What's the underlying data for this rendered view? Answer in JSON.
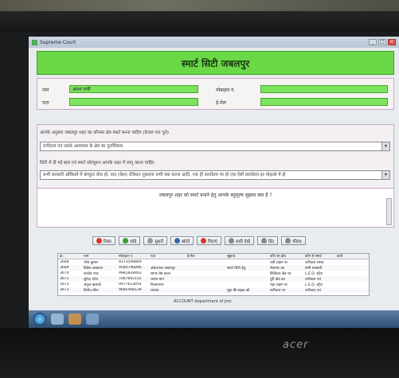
{
  "window": {
    "title": "Supreme Court"
  },
  "header": {
    "title": "स्मार्ट सिटी जबलपुर"
  },
  "form": {
    "name_label": "नाम",
    "name_value": "आशा रानी",
    "address_label": "पता",
    "mobile_label": "मोबाइल नं.",
    "email_label": "ई-मेल"
  },
  "question1": {
    "label": "आपके अनुसार जबलपुर शहर का कौनसा क्षेत्र स्मार्ट बनना चाहिए (केवल एक चुने)",
    "selected": "रानीताल एवं उसके आसपास के क्षेत्र का पुनर्विकास"
  },
  "question2": {
    "label": "सिटी में दी गई बाल एवं स्मार्ट सॉल्यूशन आपके शहर में लागू करना चाहिए",
    "selected": "सभी सरकारी ऑफ़िसों में कंप्यूटर सेवा हो, वाद (केस) रजिस्टर मुकदमा सभी क्या करना आदि, एक ही कार्यालय पर हो एक ऐसी कार्यालय हर मोहल्ले में हो"
  },
  "suggestion": {
    "question": "जबलपुर शहर को स्मार्ट बनाने हेतु आपके बहुमूल्य सुझाव क्या है ?"
  },
  "buttons": [
    {
      "label": "रिक्त",
      "color": "#d9342b"
    },
    {
      "label": "जोड़े",
      "color": "#3b9c3b"
    },
    {
      "label": "सुधारें",
      "color": "#777777"
    },
    {
      "label": "खोजें",
      "color": "#3366aa"
    },
    {
      "label": "मिटाएं",
      "color": "#d9342b"
    },
    {
      "label": "सारी देखें",
      "color": "#777777"
    },
    {
      "label": "प्रिंट",
      "color": "#777777"
    },
    {
      "label": "फील्ड",
      "color": "#777777"
    }
  ],
  "grid": {
    "columns": [
      "क्र.",
      "नाम",
      "मोबाइल न.",
      "पता",
      "ई-मेल",
      "सुझाव",
      "कौन सा क्षेत्र",
      "कौन से स्मार्ट",
      "कार्य"
    ],
    "rows": [
      [
        "3668",
        "नरेश कुमार",
        "9373549869",
        "",
        "",
        "",
        "पत्री टाइम पर",
        "रानीताल समग्र",
        ""
      ],
      [
        "3669",
        "विवेक अग्रवाल",
        "9584796896",
        "अंधारताल जबलपुर",
        "",
        "स्मार्ट सिटी हेतु",
        "रोजगार का",
        "सभी सरकारी",
        ""
      ],
      [
        "3670",
        "बलदेव पाल",
        "9981828463",
        "सागर रोड बदल",
        "",
        "",
        "डिजिटल क्षेत्र पर",
        "L.E.D. स्ट्रीट",
        ""
      ],
      [
        "3671",
        "सुरेन्द्र पटेल",
        "7067665152",
        "चरणा बाग",
        "",
        "",
        "पुरी क्षेत्र का",
        "रानीताल एवं",
        ""
      ],
      [
        "3672",
        "अनुज कलार्क",
        "9977613054",
        "विजयनगर",
        "",
        "",
        "पहा टाइम पर",
        "L.E.D. स्ट्रीट",
        ""
      ],
      [
        "3673",
        "विनोद मीना",
        "9685408139",
        "धनवंत",
        "",
        "मुद्दा की सड़क को",
        "रानीताल पर",
        "रानीताल एवं",
        ""
      ]
    ]
  },
  "footer": {
    "text": "ACCOUNT department of jmc"
  },
  "monitor": {
    "brand": "acer"
  }
}
